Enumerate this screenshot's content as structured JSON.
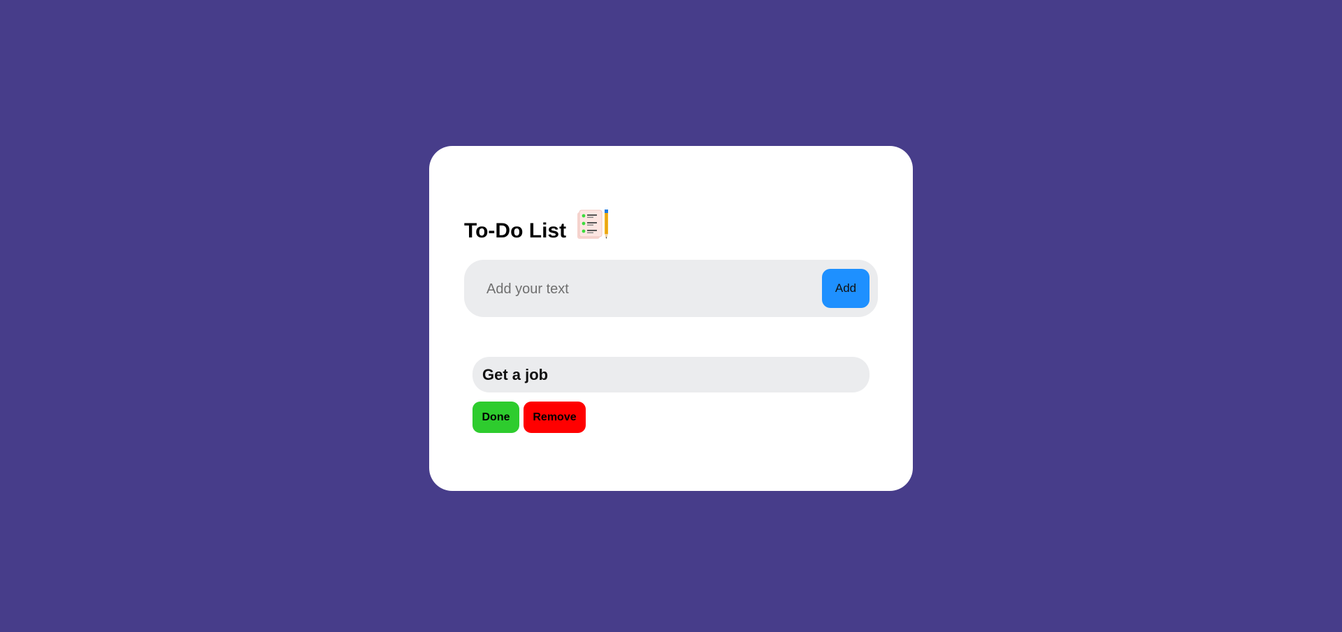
{
  "app": {
    "title": "To-Do List",
    "title_icon": "checklist-notepad-with-pencil-icon"
  },
  "colors": {
    "background": "#473d8a",
    "card": "#ffffff",
    "add_button": "#1e90ff",
    "done_button": "#2ecc2e",
    "remove_button": "#ff0000",
    "field_background": "#ebecee"
  },
  "input": {
    "value": "",
    "placeholder": "Add your text",
    "add_label": "Add"
  },
  "todos": [
    {
      "text": "Get a job",
      "done_label": "Done",
      "remove_label": "Remove"
    }
  ]
}
